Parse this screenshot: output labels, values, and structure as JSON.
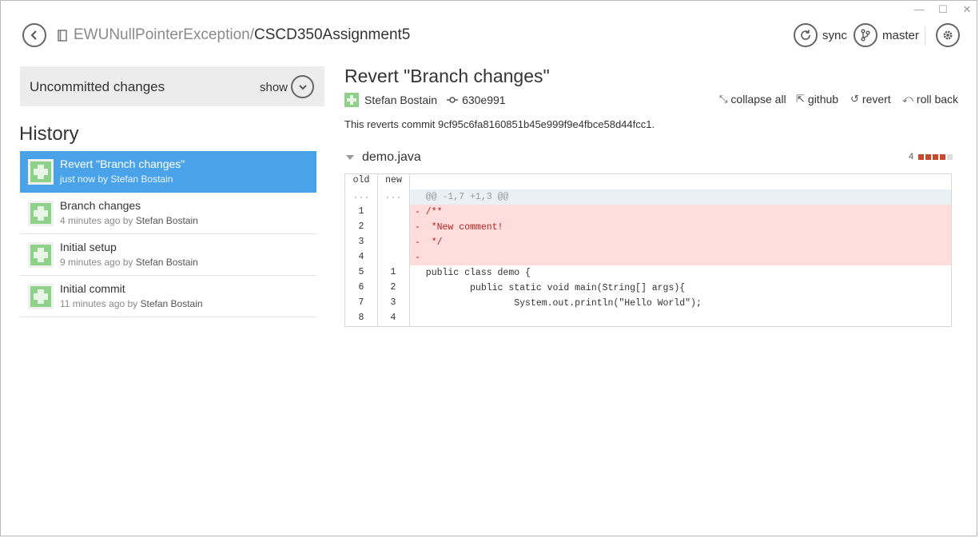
{
  "window": {
    "minimize": "—",
    "maximize": "☐",
    "close": "✕"
  },
  "repo": {
    "owner": "EWUNullPointerException/",
    "name": "CSCD350Assignment5"
  },
  "toolbar": {
    "sync_label": "sync",
    "branch_label": "master"
  },
  "uncommitted": {
    "label": "Uncommitted changes",
    "show_label": "show"
  },
  "history": {
    "title": "History",
    "items": [
      {
        "message": "Revert \"Branch changes\"",
        "time": "just now by ",
        "author": "Stefan Bostain"
      },
      {
        "message": "Branch changes",
        "time": "4 minutes ago by ",
        "author": "Stefan Bostain"
      },
      {
        "message": "Initial setup",
        "time": "9 minutes ago by ",
        "author": "Stefan Bostain"
      },
      {
        "message": "Initial commit",
        "time": "11 minutes ago by ",
        "author": "Stefan Bostain"
      }
    ]
  },
  "commit": {
    "title": "Revert \"Branch changes\"",
    "author": "Stefan Bostain",
    "sha": "630e991",
    "description": "This reverts commit 9cf95c6fa8160851b45e999f9e4fbce58d44fcc1.",
    "actions": {
      "collapse": "collapse all",
      "github": "github",
      "revert": "revert",
      "rollback": "roll back"
    }
  },
  "file": {
    "name": "demo.java",
    "change_count": "4",
    "deletion_blocks": 4
  },
  "diff": {
    "headers": {
      "old": "old",
      "new": "new"
    },
    "rows": [
      {
        "old": "...",
        "new": "...",
        "text": "  @@ -1,7 +1,3 @@"
      },
      {
        "old": "1",
        "new": "",
        "text": "- /**"
      },
      {
        "old": "2",
        "new": "",
        "text": "-  *New comment!"
      },
      {
        "old": "3",
        "new": "",
        "text": "-  */"
      },
      {
        "old": "4",
        "new": "",
        "text": "-"
      },
      {
        "old": "5",
        "new": "1",
        "text": "  public class demo {"
      },
      {
        "old": "6",
        "new": "2",
        "text": "          public static void main(String[] args){"
      },
      {
        "old": "7",
        "new": "3",
        "text": "                  System.out.println(\"Hello World\");"
      },
      {
        "old": "8",
        "new": "4",
        "text": ""
      }
    ]
  },
  "colors": {
    "selected": "#4aa3e8",
    "deletion_bg": "#ffdddd",
    "hunk_bg": "#e9f1f5",
    "stat_block": "#c8482b",
    "avatar": "#8fd18a"
  }
}
